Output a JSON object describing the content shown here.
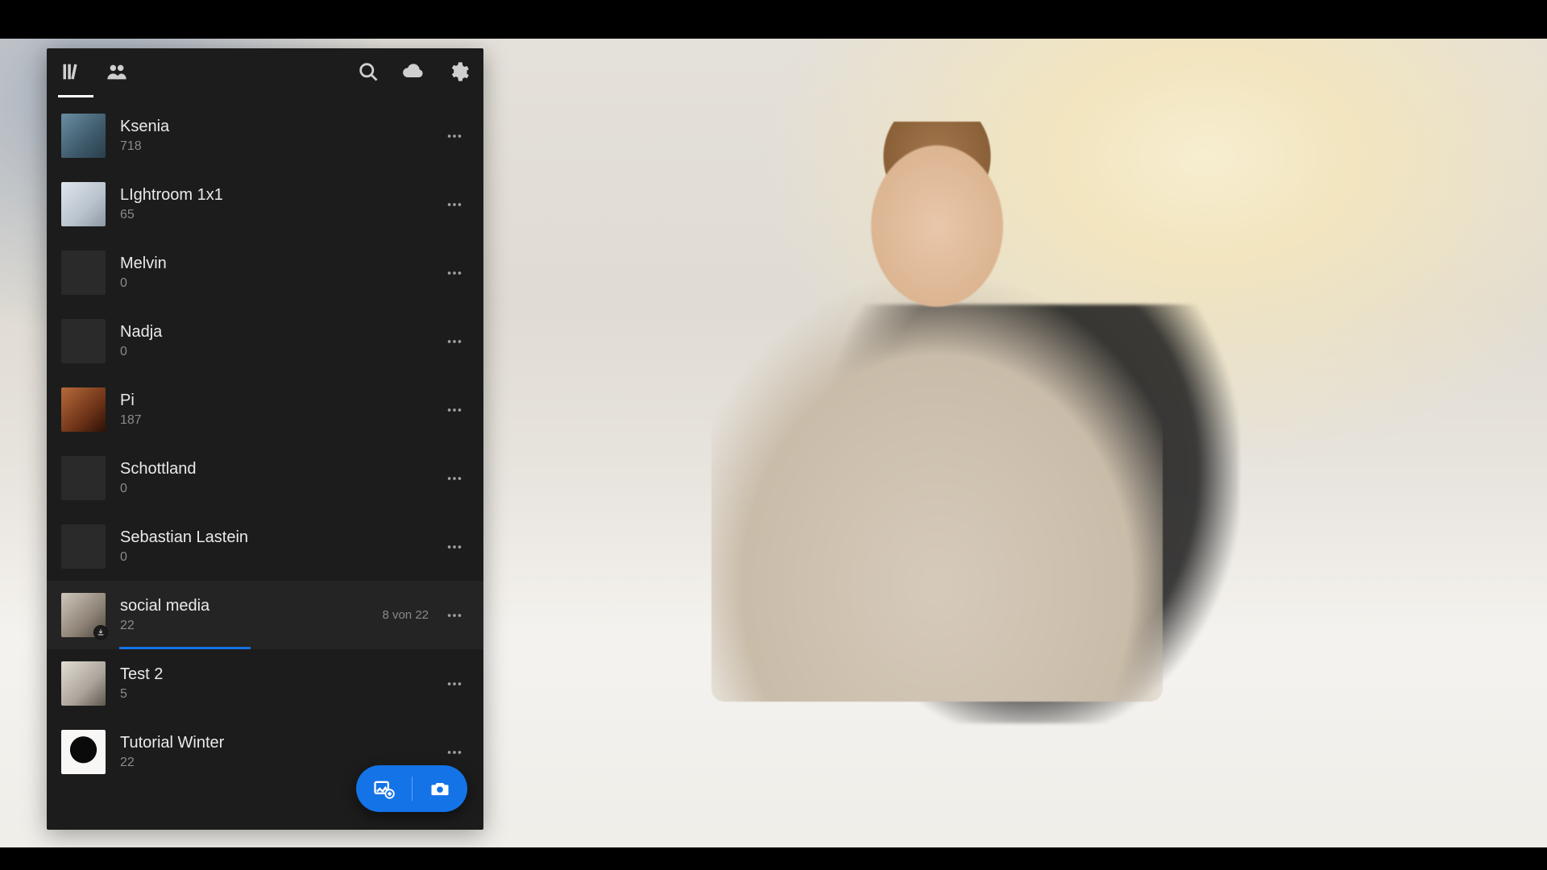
{
  "albums": [
    {
      "title": "Ksenia",
      "count": "718",
      "thumb": "t1"
    },
    {
      "title": "LIghtroom 1x1",
      "count": "65",
      "thumb": "t2"
    },
    {
      "title": "Melvin",
      "count": "0",
      "thumb": ""
    },
    {
      "title": "Nadja",
      "count": "0",
      "thumb": ""
    },
    {
      "title": "Pi",
      "count": "187",
      "thumb": "t5"
    },
    {
      "title": "Schottland",
      "count": "0",
      "thumb": ""
    },
    {
      "title": "Sebastian Lastein",
      "count": "0",
      "thumb": ""
    },
    {
      "title": "social media",
      "count": "22",
      "thumb": "t8",
      "selected": true,
      "status": "8 von 22",
      "progress_pct": 36,
      "badge": true
    },
    {
      "title": "Test 2",
      "count": "5",
      "thumb": "t9"
    },
    {
      "title": "Tutorial Winter",
      "count": "22",
      "thumb": "t10"
    }
  ]
}
